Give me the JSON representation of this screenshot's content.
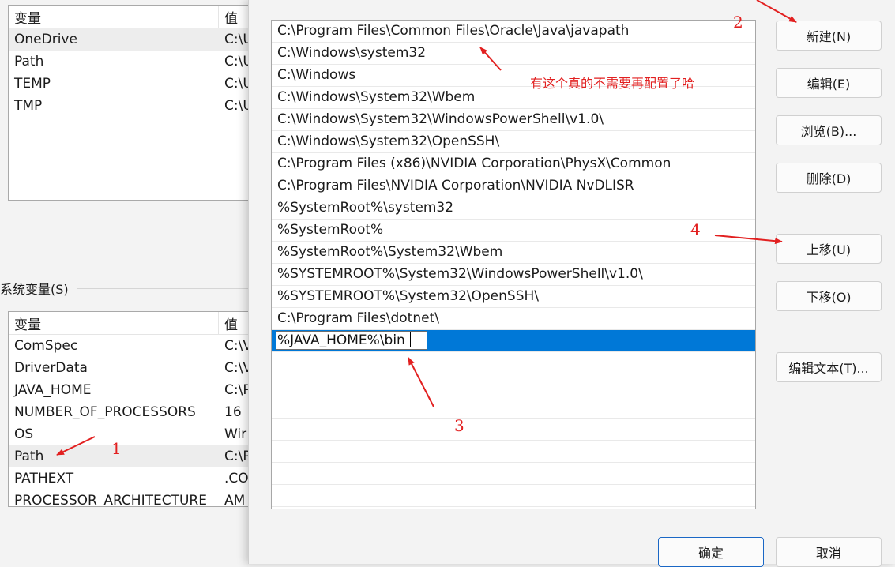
{
  "user_vars": {
    "header": {
      "name": "变量",
      "value": "值"
    },
    "rows": [
      {
        "name": "OneDrive",
        "value": "C:\\U"
      },
      {
        "name": "Path",
        "value": "C:\\U"
      },
      {
        "name": "TEMP",
        "value": "C:\\U"
      },
      {
        "name": "TMP",
        "value": "C:\\U"
      }
    ]
  },
  "system_vars": {
    "label": "系统变量(S)",
    "header": {
      "name": "变量",
      "value": "值"
    },
    "rows": [
      {
        "name": "ComSpec",
        "value": "C:\\V"
      },
      {
        "name": "DriverData",
        "value": "C:\\V"
      },
      {
        "name": "JAVA_HOME",
        "value": "C:\\P"
      },
      {
        "name": "NUMBER_OF_PROCESSORS",
        "value": "16"
      },
      {
        "name": "OS",
        "value": "Wir"
      },
      {
        "name": "Path",
        "value": "C:\\P"
      },
      {
        "name": "PATHEXT",
        "value": ".CO"
      },
      {
        "name": "PROCESSOR_ARCHITECTURE",
        "value": "AM"
      }
    ]
  },
  "path_entries": [
    "C:\\Program Files\\Common Files\\Oracle\\Java\\javapath",
    "C:\\Windows\\system32",
    "C:\\Windows",
    "C:\\Windows\\System32\\Wbem",
    "C:\\Windows\\System32\\WindowsPowerShell\\v1.0\\",
    "C:\\Windows\\System32\\OpenSSH\\",
    "C:\\Program Files (x86)\\NVIDIA Corporation\\PhysX\\Common",
    "C:\\Program Files\\NVIDIA Corporation\\NVIDIA NvDLISR",
    "%SystemRoot%\\system32",
    "%SystemRoot%",
    "%SystemRoot%\\System32\\Wbem",
    "%SYSTEMROOT%\\System32\\WindowsPowerShell\\v1.0\\",
    "%SYSTEMROOT%\\System32\\OpenSSH\\",
    "C:\\Program Files\\dotnet\\"
  ],
  "editing_entry": "%JAVA_HOME%\\bin",
  "buttons": {
    "new": "新建(N)",
    "edit": "编辑(E)",
    "browse": "浏览(B)...",
    "delete": "删除(D)",
    "move_up": "上移(U)",
    "move_down": "下移(O)",
    "edit_text": "编辑文本(T)...",
    "ok": "确定",
    "cancel": "取消"
  },
  "annotations": {
    "n1": "1",
    "n2": "2",
    "n3": "3",
    "n4": "4",
    "note": "有这个真的不需要再配置了哈",
    "color": "#e22020"
  }
}
